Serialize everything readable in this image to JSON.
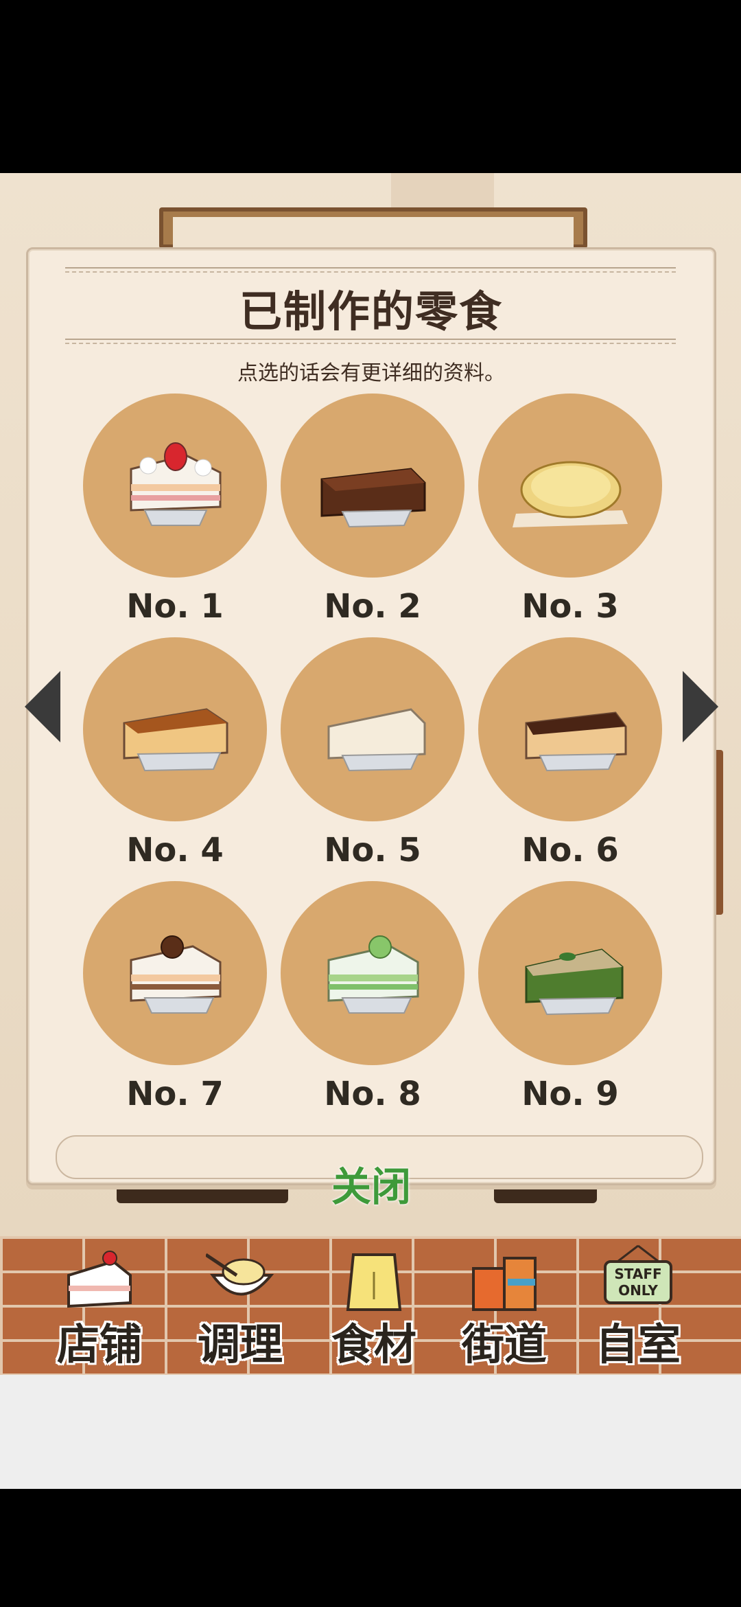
{
  "dialog": {
    "title": "已制作的零食",
    "subtitle": "点选的话会有更详细的资料。",
    "close_label": "关闭"
  },
  "snacks": [
    {
      "label": "No. 1",
      "icon": "strawberry-shortcake-icon"
    },
    {
      "label": "No. 2",
      "icon": "chocolate-cake-icon"
    },
    {
      "label": "No. 3",
      "icon": "lemon-tart-icon"
    },
    {
      "label": "No. 4",
      "icon": "basque-cheesecake-icon"
    },
    {
      "label": "No. 5",
      "icon": "white-cheesecake-icon"
    },
    {
      "label": "No. 6",
      "icon": "chocolate-cheesecake-icon"
    },
    {
      "label": "No. 7",
      "icon": "chestnut-shortcake-icon"
    },
    {
      "label": "No. 8",
      "icon": "melon-shortcake-icon"
    },
    {
      "label": "No. 9",
      "icon": "matcha-cake-icon"
    }
  ],
  "bottom_nav": [
    {
      "label": "店铺",
      "icon": "shortcake-icon"
    },
    {
      "label": "调理",
      "icon": "mixing-bowl-icon"
    },
    {
      "label": "食材",
      "icon": "flour-bag-icon"
    },
    {
      "label": "街道",
      "icon": "shops-icon"
    },
    {
      "label": "自室",
      "icon": "staff-only-sign-icon"
    }
  ],
  "staff_sign_text": [
    "STAFF",
    "ONLY"
  ],
  "colors": {
    "circle": "#d8a86e",
    "close_text": "#3e9a3a",
    "title_text": "#3f2d22",
    "brick": "#b8683d"
  }
}
